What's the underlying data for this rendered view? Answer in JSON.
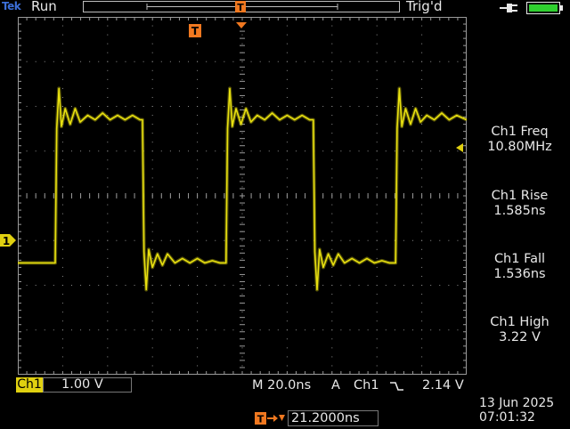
{
  "header": {
    "brand": "Tek",
    "run_state": "Run",
    "trigger_state": "Trig'd"
  },
  "icons": {
    "power": "ac-plug-icon",
    "battery": "battery-icon",
    "trigger_marker": "trigger-position-icon",
    "trigger_slope": "falling-edge-icon"
  },
  "colors": {
    "background": "#000000",
    "trace": "#e8e010",
    "accent": "#f07820",
    "battery": "#2fd02f"
  },
  "channel": {
    "name": "Ch1",
    "marker_label": "1",
    "scale": "1.00 V"
  },
  "timebase": {
    "label": "M 20.0ns"
  },
  "trigger": {
    "marker_label": "T",
    "source_label": "A",
    "channel": "Ch1",
    "level": "2.14 V",
    "position": "21.2000ns"
  },
  "measurements": [
    {
      "label": "Ch1 Freq",
      "value": "10.80MHz"
    },
    {
      "label": "Ch1 Rise",
      "value": "1.585ns"
    },
    {
      "label": "Ch1 Fall",
      "value": "1.536ns"
    },
    {
      "label": "Ch1 High",
      "value": "3.22 V"
    }
  ],
  "datetime": {
    "date": "13 Jun  2025",
    "time": "07:01:32"
  },
  "chart_data": {
    "type": "line",
    "grid": true,
    "x": [
      0,
      15,
      15.6,
      16.5,
      17.5,
      19,
      21,
      23,
      25,
      28,
      31,
      34,
      37,
      40,
      43,
      46,
      49,
      50,
      50.6,
      51.5,
      52.5,
      54,
      56,
      58,
      60,
      63,
      66,
      69,
      72,
      75,
      78,
      81,
      83.5,
      84.1,
      85,
      86,
      87.5,
      89.5,
      91.5,
      93.5,
      96,
      99,
      102,
      105,
      108,
      111,
      114,
      117,
      118.5,
      119.1,
      120,
      121,
      122.5,
      124.5,
      126.5,
      128.5,
      131,
      134,
      137,
      140,
      143,
      146,
      149,
      151.5,
      152.1,
      153,
      154,
      155.5,
      157.5,
      159.5,
      161.5,
      164,
      167,
      170,
      173,
      176,
      180
    ],
    "series": [
      {
        "name": "Ch1",
        "values": [
          0.0,
          0.0,
          3.0,
          3.9,
          3.05,
          3.45,
          3.1,
          3.45,
          3.15,
          3.3,
          3.2,
          3.35,
          3.2,
          3.3,
          3.2,
          3.3,
          3.2,
          3.2,
          0.25,
          -0.6,
          0.3,
          -0.1,
          0.2,
          -0.05,
          0.2,
          0.0,
          0.1,
          0.0,
          0.1,
          0.0,
          0.05,
          0.0,
          0.0,
          3.0,
          3.9,
          3.05,
          3.45,
          3.1,
          3.45,
          3.15,
          3.3,
          3.2,
          3.35,
          3.2,
          3.3,
          3.2,
          3.3,
          3.2,
          3.2,
          0.25,
          -0.6,
          0.3,
          -0.1,
          0.2,
          -0.05,
          0.2,
          0.0,
          0.1,
          0.0,
          0.1,
          0.0,
          0.05,
          0.0,
          0.0,
          3.0,
          3.9,
          3.05,
          3.45,
          3.1,
          3.45,
          3.15,
          3.3,
          3.2,
          3.35,
          3.2,
          3.3,
          3.2
        ]
      }
    ],
    "xlim": [
      0,
      180
    ],
    "ylim": [
      -2.5,
      5.5
    ],
    "x_divisions": 10,
    "y_divisions": 8
  }
}
